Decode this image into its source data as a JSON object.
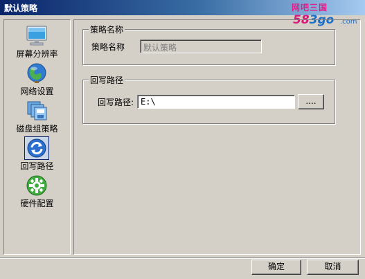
{
  "window": {
    "title": "默认策略"
  },
  "watermark": {
    "top": "网吧三国",
    "bottom_pink": "58",
    "bottom_blue": "3go",
    "suffix": ".com"
  },
  "sidebar": {
    "items": [
      {
        "label": "屏幕分辨率",
        "icon": "monitor-icon"
      },
      {
        "label": "网络设置",
        "icon": "globe-network-icon"
      },
      {
        "label": "磁盘组策略",
        "icon": "disk-group-icon"
      },
      {
        "label": "回写路径",
        "icon": "writeback-refresh-icon",
        "selected": true
      },
      {
        "label": "硬件配置",
        "icon": "hardware-gear-icon"
      }
    ]
  },
  "policy_name_group": {
    "title": "策略名称",
    "label": "策略名称",
    "value": "默认策略"
  },
  "writeback_group": {
    "title": "回写路径",
    "label": "回写路径:",
    "value": "E:\\",
    "browse_label": "...."
  },
  "footer": {
    "ok_label": "确定",
    "cancel_label": "取消"
  }
}
